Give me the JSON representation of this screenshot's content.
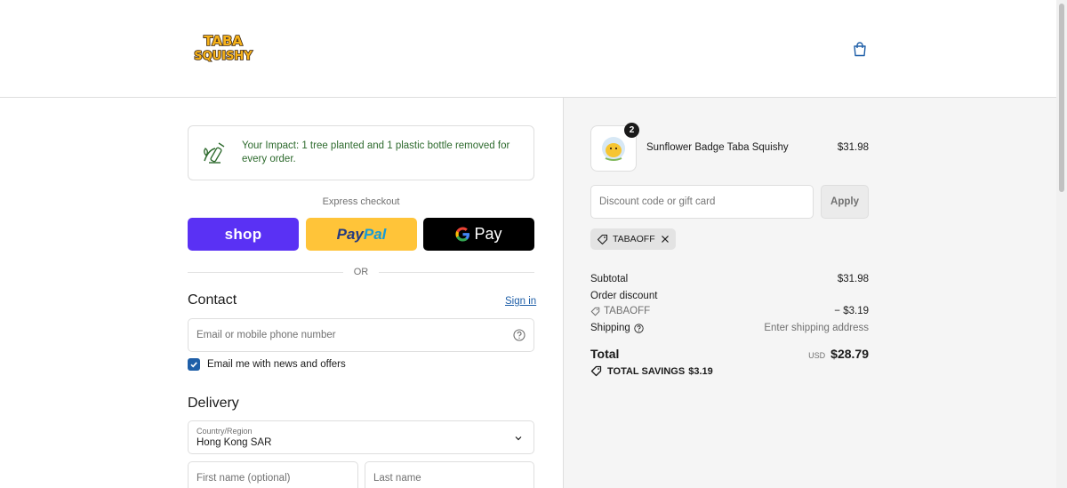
{
  "brand": {
    "logo_line1": "TABA",
    "logo_line2": "SQUISHY"
  },
  "impact": {
    "text": "Your Impact: 1 tree planted and 1 plastic bottle removed for every order."
  },
  "express": {
    "label": "Express checkout",
    "shop_label": "shop",
    "paypal_label_1": "Pay",
    "paypal_label_2": "Pal",
    "gpay_label": "Pay"
  },
  "divider": {
    "or": "OR"
  },
  "contact": {
    "title": "Contact",
    "sign_in": "Sign in",
    "email_placeholder": "Email or mobile phone number",
    "newsletter_label": "Email me with news and offers",
    "newsletter_checked": true
  },
  "delivery": {
    "title": "Delivery",
    "country_label": "Country/Region",
    "country_value": "Hong Kong SAR",
    "first_name_placeholder": "First name (optional)",
    "last_name_placeholder": "Last name"
  },
  "summary": {
    "item": {
      "quantity": "2",
      "name": "Sunflower Badge Taba Squishy",
      "price": "$31.98"
    },
    "discount_placeholder": "Discount code or gift card",
    "apply_label": "Apply",
    "applied_code": "TABAOFF",
    "subtotal_label": "Subtotal",
    "subtotal_value": "$31.98",
    "order_discount_label": "Order discount",
    "discount_code": "TABAOFF",
    "discount_value": "− $3.19",
    "shipping_label": "Shipping",
    "shipping_value": "Enter shipping address",
    "total_label": "Total",
    "total_currency": "USD",
    "total_value": "$28.79",
    "savings_label": "TOTAL SAVINGS",
    "savings_value": "$3.19"
  },
  "colors": {
    "shop_purple": "#5a31f4",
    "paypal_yellow": "#ffc439",
    "gpay_black": "#000000",
    "link_blue": "#1f5fa8",
    "impact_green": "#2d6a2d"
  },
  "icons": [
    "cart-icon",
    "plant-bottle-icon",
    "help-circle-icon",
    "checkmark-icon",
    "chevron-down-icon",
    "tag-icon",
    "close-icon"
  ]
}
